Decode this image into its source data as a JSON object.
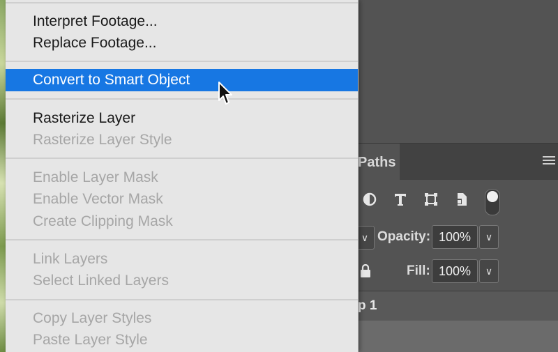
{
  "context_menu": {
    "items": [
      {
        "label": "Interpret Footage...",
        "enabled": true
      },
      {
        "label": "Replace Footage...",
        "enabled": true
      },
      {
        "label": "Convert to Smart Object",
        "enabled": true,
        "highlighted": true
      },
      {
        "label": "Rasterize Layer",
        "enabled": true
      },
      {
        "label": "Rasterize Layer Style",
        "enabled": false
      },
      {
        "label": "Enable Layer Mask",
        "enabled": false
      },
      {
        "label": "Enable Vector Mask",
        "enabled": false
      },
      {
        "label": "Create Clipping Mask",
        "enabled": false
      },
      {
        "label": "Link Layers",
        "enabled": false
      },
      {
        "label": "Select Linked Layers",
        "enabled": false
      },
      {
        "label": "Copy Layer Styles",
        "enabled": false
      },
      {
        "label": "Paste Layer Style",
        "enabled": false
      }
    ]
  },
  "layers_panel": {
    "tab_label": "Paths",
    "filter_icons": [
      "adjustment-filter-icon",
      "type-filter-icon",
      "shape-filter-icon",
      "smart-object-filter-icon"
    ],
    "opacity_label": "Opacity:",
    "opacity_value": "100%",
    "fill_label": "Fill:",
    "fill_value": "100%",
    "layer_name_fragment": "p 1"
  },
  "colors": {
    "highlight": "#1777e3",
    "menu_bg": "#e6e6e6",
    "panel_bg": "#535353"
  }
}
